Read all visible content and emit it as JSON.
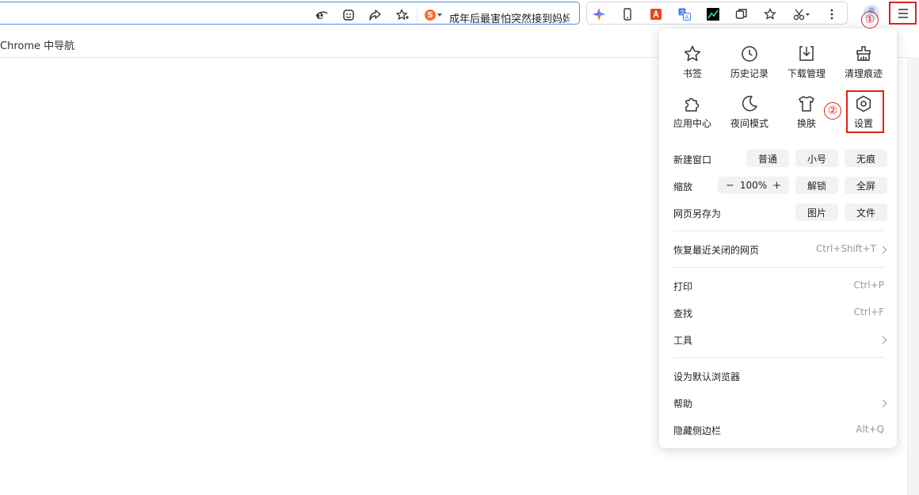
{
  "omnibox": {
    "search_engine_icon": "sogou-icon",
    "hot_search_text": "成年后最害怕突然接到妈妈"
  },
  "extensions": [
    "colorful-star-icon",
    "phone-icon",
    "pdf-icon",
    "translate-icon",
    "chart-icon",
    "copy-icon",
    "star-icon",
    "scissors-icon",
    "more-icon"
  ],
  "bookmarks": {
    "item": "Chrome 中导航"
  },
  "annotations": {
    "step1": "①",
    "step2": "②",
    "color": "#e0201b"
  },
  "menu": {
    "tiles": [
      {
        "label": "书签",
        "icon": "star-icon"
      },
      {
        "label": "历史记录",
        "icon": "clock-icon"
      },
      {
        "label": "下载管理",
        "icon": "download-icon"
      },
      {
        "label": "清理痕迹",
        "icon": "broom-icon"
      },
      {
        "label": "应用中心",
        "icon": "puzzle-icon"
      },
      {
        "label": "夜间模式",
        "icon": "moon-icon"
      },
      {
        "label": "换肤",
        "icon": "shirt-icon"
      },
      {
        "label": "设置",
        "icon": "gear-icon"
      }
    ],
    "new_window": {
      "label": "新建窗口",
      "normal": "普通",
      "small": "小号",
      "incognito": "无痕"
    },
    "zoom": {
      "label": "缩放",
      "minus": "−",
      "value": "100%",
      "plus": "+",
      "unlock": "解锁",
      "fullscreen": "全屏"
    },
    "save_as": {
      "label": "网页另存为",
      "image": "图片",
      "file": "文件"
    },
    "restore": {
      "label": "恢复最近关闭的网页",
      "shortcut": "Ctrl+Shift+T"
    },
    "print": {
      "label": "打印",
      "shortcut": "Ctrl+P"
    },
    "find": {
      "label": "查找",
      "shortcut": "Ctrl+F"
    },
    "tools": {
      "label": "工具"
    },
    "default_browser": {
      "label": "设为默认浏览器"
    },
    "help": {
      "label": "帮助"
    },
    "hide_sidebar": {
      "label": "隐藏侧边栏",
      "shortcut": "Alt+Q"
    }
  }
}
